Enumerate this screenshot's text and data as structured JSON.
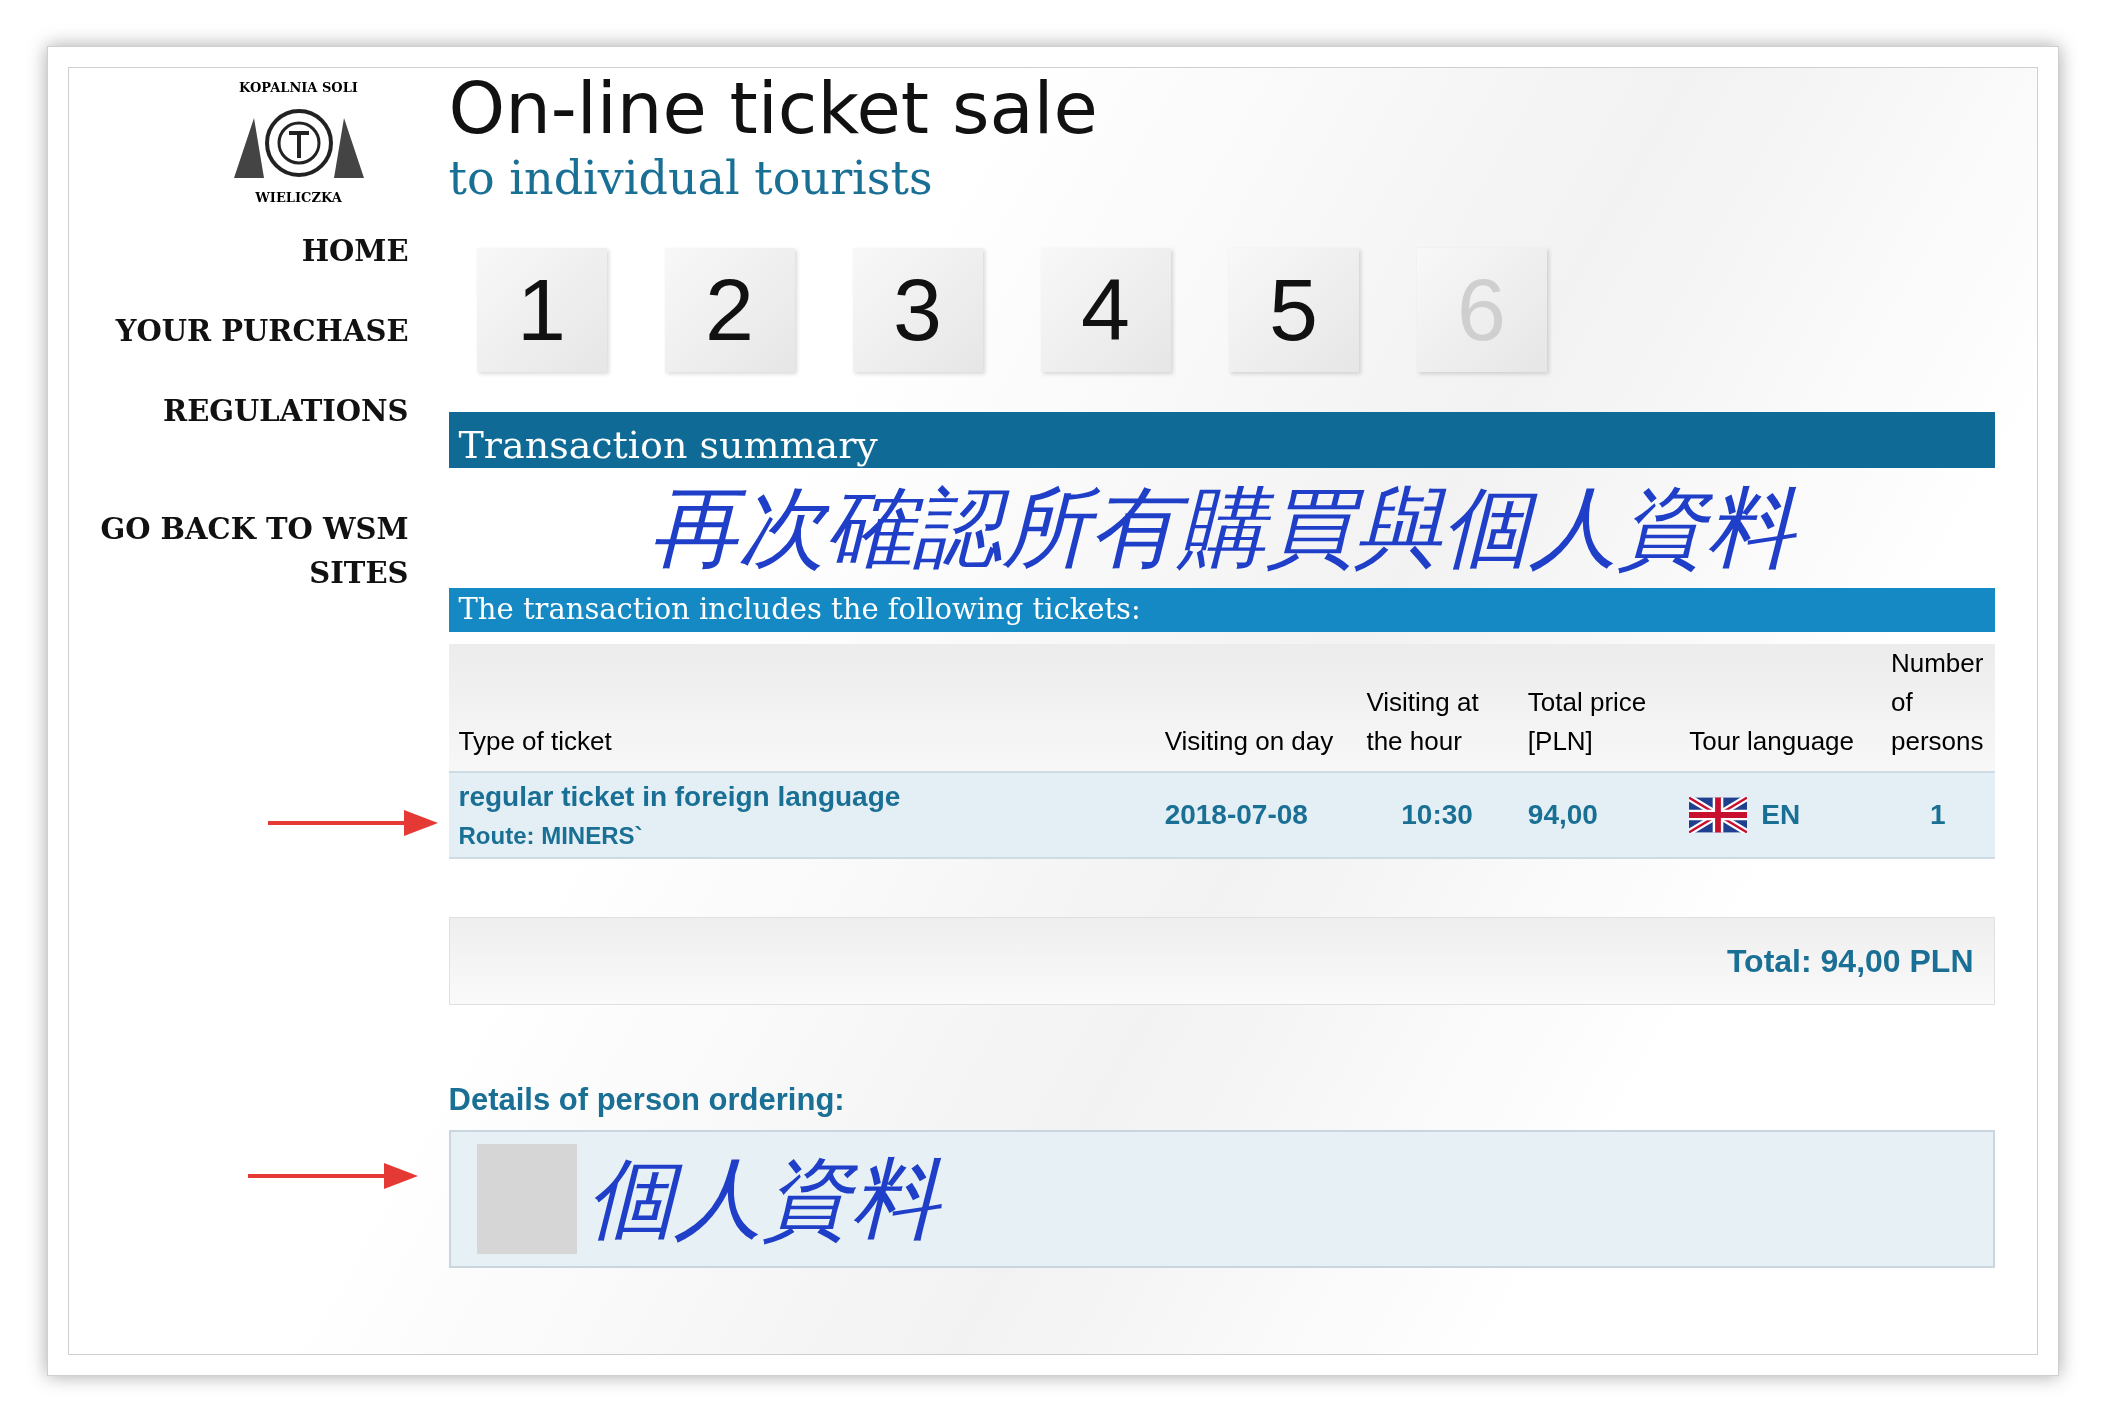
{
  "logo": {
    "top_text": "KOPALNIA SOLI",
    "bottom_text": "WIELICZKA"
  },
  "nav": [
    {
      "label": "HOME"
    },
    {
      "label": "YOUR PURCHASE"
    },
    {
      "label": "REGULATIONS"
    },
    {
      "label": "GO BACK TO WSM SITES"
    }
  ],
  "header": {
    "title": "On-line ticket sale",
    "subtitle": "to individual tourists"
  },
  "steps": [
    {
      "label": "1",
      "disabled": false
    },
    {
      "label": "2",
      "disabled": false
    },
    {
      "label": "3",
      "disabled": false
    },
    {
      "label": "4",
      "disabled": false
    },
    {
      "label": "5",
      "disabled": false
    },
    {
      "label": "6",
      "disabled": true
    }
  ],
  "summary_title": "Transaction summary",
  "annotation_top": "再次確認所有購買與個人資料",
  "tickets_title": "The transaction includes the following tickets:",
  "table": {
    "columns": [
      "Type of ticket",
      "Visiting on day",
      "Visiting at the hour",
      "Total price [PLN]",
      "Tour language",
      "Number of persons"
    ],
    "rows": [
      {
        "ticket": "regular ticket in foreign language",
        "route": "Route: MINERS`",
        "day": "2018-07-08",
        "hour": "10:30",
        "price": "94,00",
        "language": "EN",
        "persons": "1"
      }
    ]
  },
  "total": "Total: 94,00 PLN",
  "details_title": "Details of person ordering:",
  "annotation_details": "個人資料"
}
